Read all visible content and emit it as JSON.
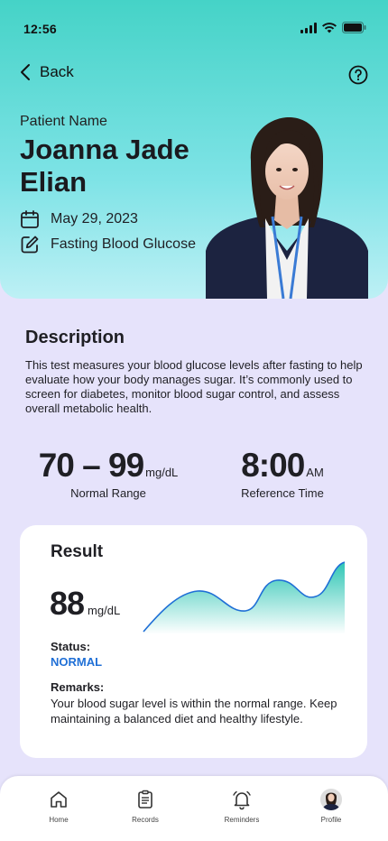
{
  "status_bar": {
    "time": "12:56"
  },
  "nav": {
    "back_label": "Back"
  },
  "patient": {
    "label": "Patient Name",
    "name": "Joanna Jade Elian",
    "date": "May 29, 2023",
    "test": "Fasting Blood Glucose"
  },
  "description": {
    "title": "Description",
    "text": "This test measures your blood glucose levels after fasting to help evaluate how your body manages sugar. It’s commonly used to screen for diabetes, monitor blood sugar control, and assess overall metabolic health."
  },
  "normal_range": {
    "value": "70 – 99",
    "unit": "mg/dL",
    "caption": "Normal Range"
  },
  "reference_time": {
    "value": "8:00",
    "unit": "AM",
    "caption": "Reference Time"
  },
  "result": {
    "title": "Result",
    "value": "88",
    "unit": "mg/dL",
    "status_label": "Status:",
    "status": "NORMAL",
    "status_color": "#1f6fd6",
    "remarks_label": "Remarks:",
    "remarks": "Your blood sugar level is within the normal range. Keep maintaining a balanced diet and healthy lifestyle."
  },
  "tabs": [
    {
      "label": "Home",
      "icon": "home-icon"
    },
    {
      "label": "Records",
      "icon": "records-icon"
    },
    {
      "label": "Reminders",
      "icon": "bell-icon"
    },
    {
      "label": "Profile",
      "icon": "avatar"
    }
  ],
  "colors": {
    "accent": "#45d3c7",
    "background": "#e6e3fb",
    "chart_line": "#1f6fd6"
  }
}
